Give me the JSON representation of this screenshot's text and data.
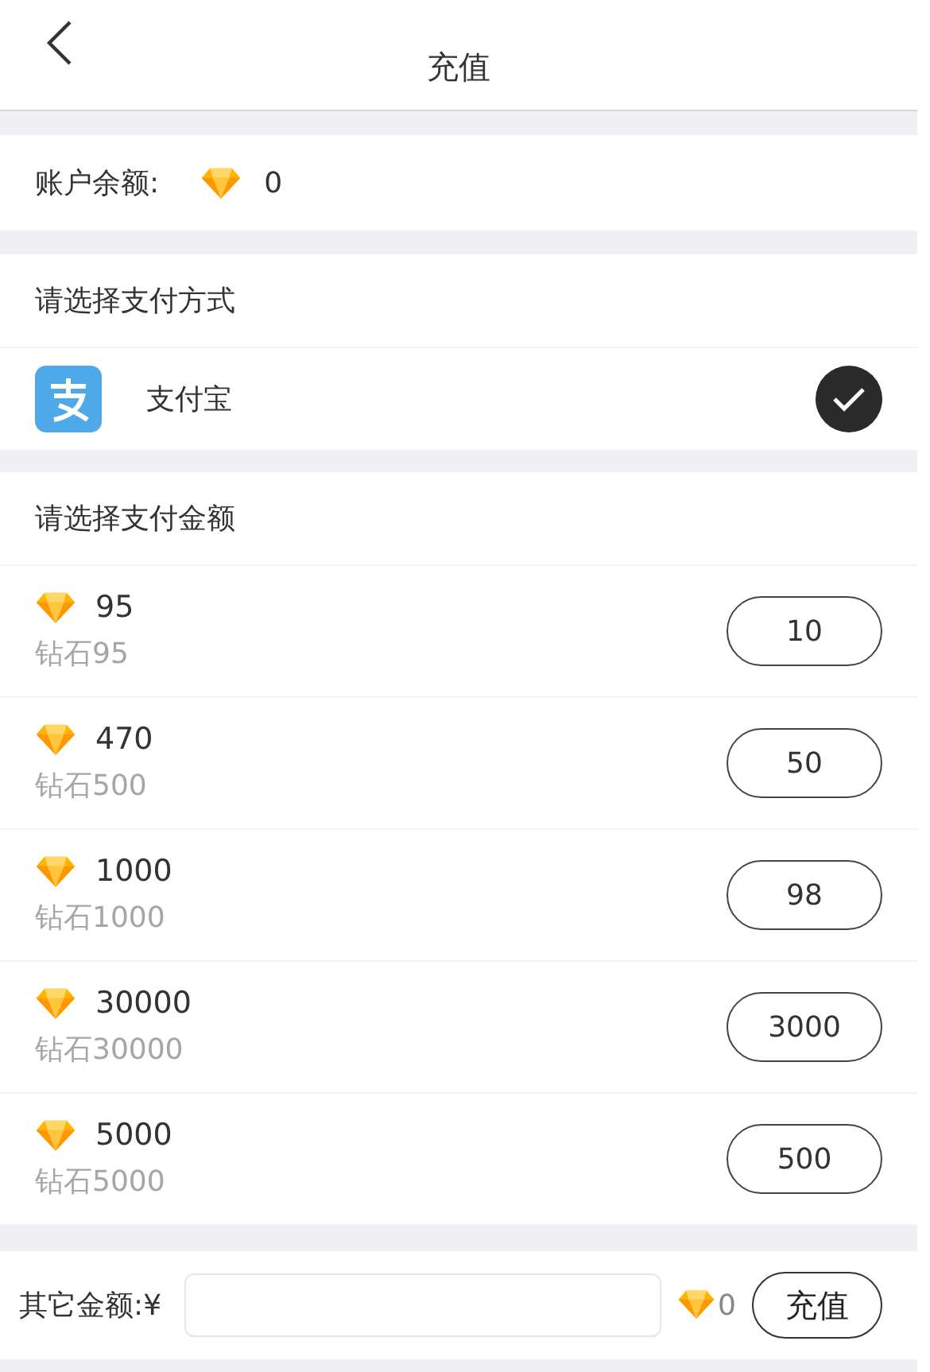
{
  "nav": {
    "title": "充值"
  },
  "balance": {
    "label": "账户余额:",
    "amount": "0"
  },
  "payment": {
    "heading": "请选择支付方式",
    "methods": [
      {
        "name": "支付宝",
        "selected": true
      }
    ]
  },
  "amounts": {
    "heading": "请选择支付金额",
    "packages": [
      {
        "diamonds": "95",
        "subtitle": "钻石95",
        "price": "10"
      },
      {
        "diamonds": "470",
        "subtitle": "钻石500",
        "price": "50"
      },
      {
        "diamonds": "1000",
        "subtitle": "钻石1000",
        "price": "98"
      },
      {
        "diamonds": "30000",
        "subtitle": "钻石30000",
        "price": "3000"
      },
      {
        "diamonds": "5000",
        "subtitle": "钻石5000",
        "price": "500"
      }
    ]
  },
  "other": {
    "label": "其它金额:¥",
    "diamonds": "0",
    "button": "充值"
  }
}
